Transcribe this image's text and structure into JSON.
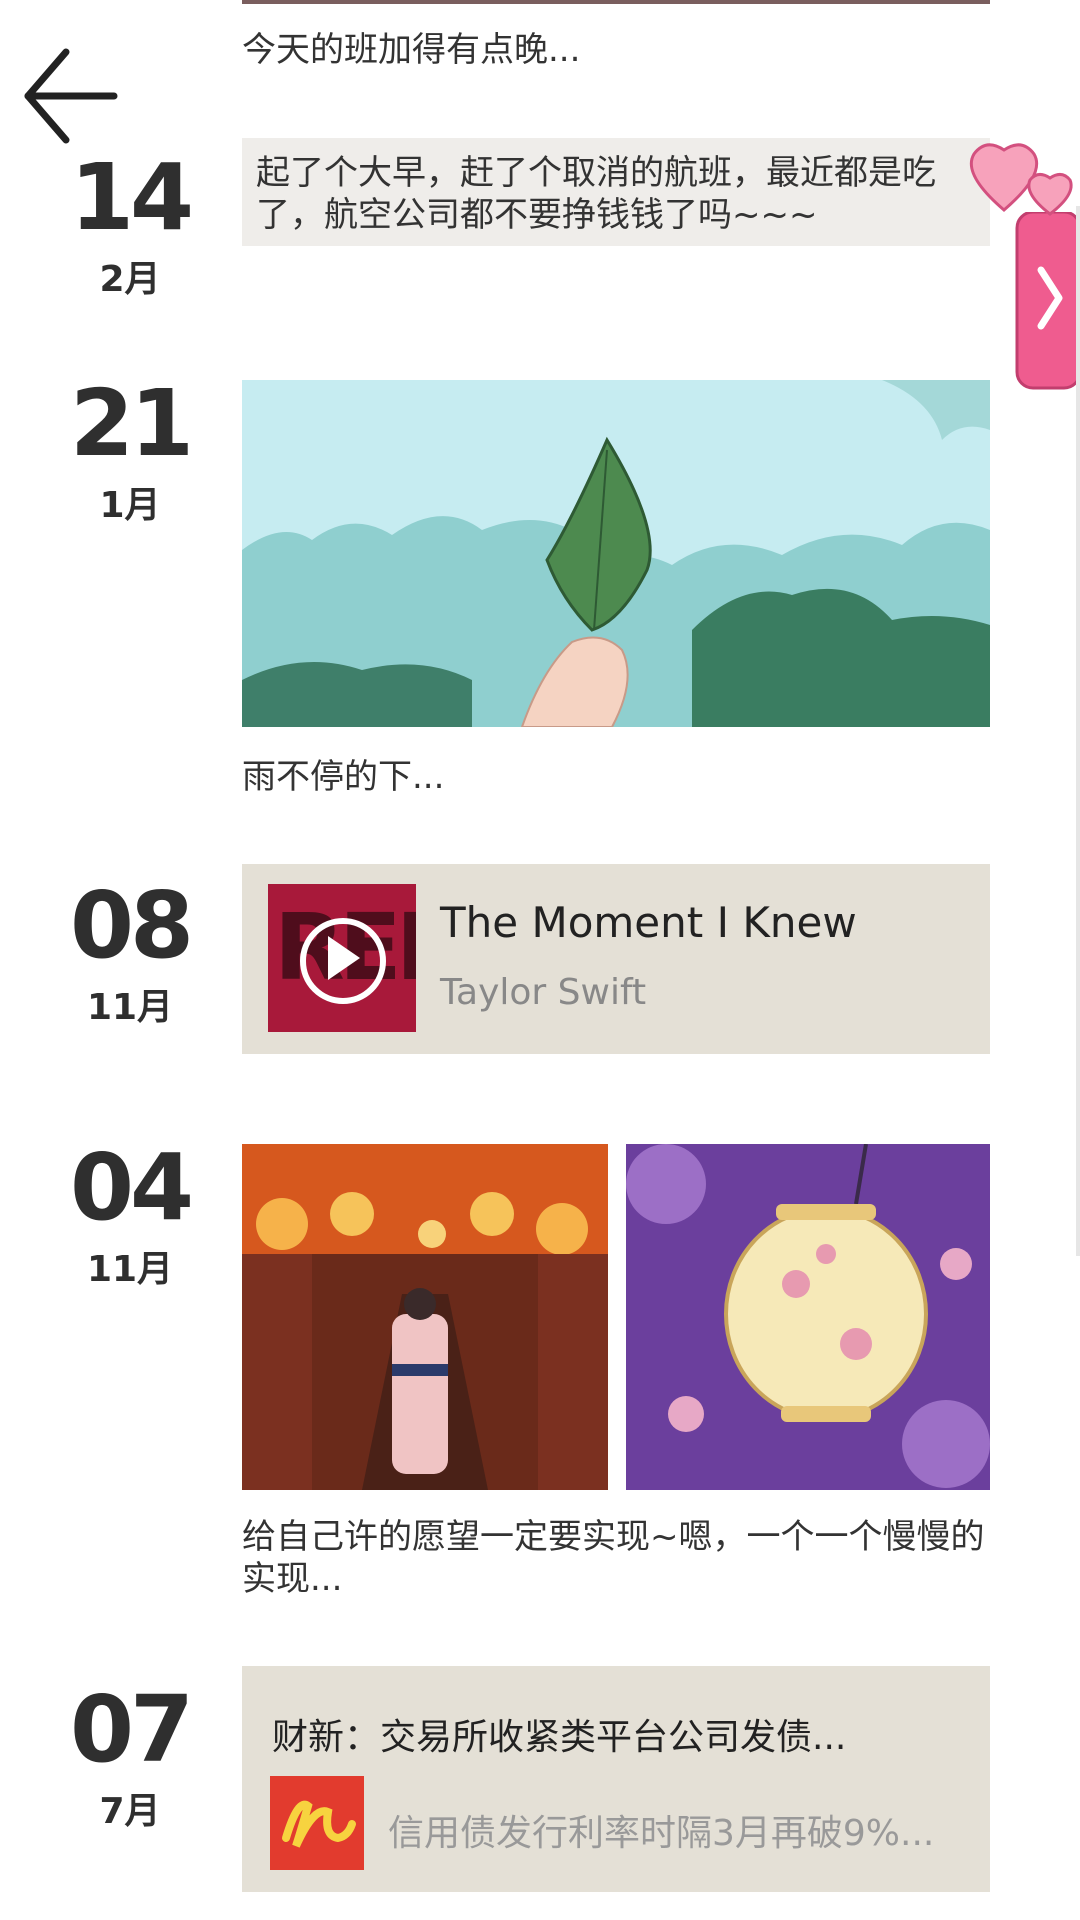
{
  "top_post": {
    "caption": "今天的班加得有点晚..."
  },
  "posts": [
    {
      "day": "14",
      "month": "2月",
      "text": "起了个大早，赶了个取消的航班，最近都是吃了，航空公司都不要挣钱钱了吗~~~"
    },
    {
      "day": "21",
      "month": "1月",
      "caption": "雨不停的下..."
    },
    {
      "day": "08",
      "month": "11月",
      "music": {
        "title": "The Moment I Knew",
        "artist": "Taylor Swift",
        "album_letters": "RED"
      }
    },
    {
      "day": "04",
      "month": "11月",
      "caption": "给自己许的愿望一定要实现~嗯，一个一个慢慢的实现..."
    },
    {
      "day": "07",
      "month": "7月",
      "news": {
        "title": "财新：交易所收紧类平台公司发债...",
        "desc": "信用债发行利率时隔3月再破9%..."
      }
    }
  ],
  "icons": {
    "back": "back-arrow-icon",
    "side": "chevron-right-icon",
    "play": "play-icon"
  },
  "colors": {
    "card_bg": "#e4e0d6",
    "text_card_bg": "#efedea",
    "pink": "#ef5c8f"
  }
}
